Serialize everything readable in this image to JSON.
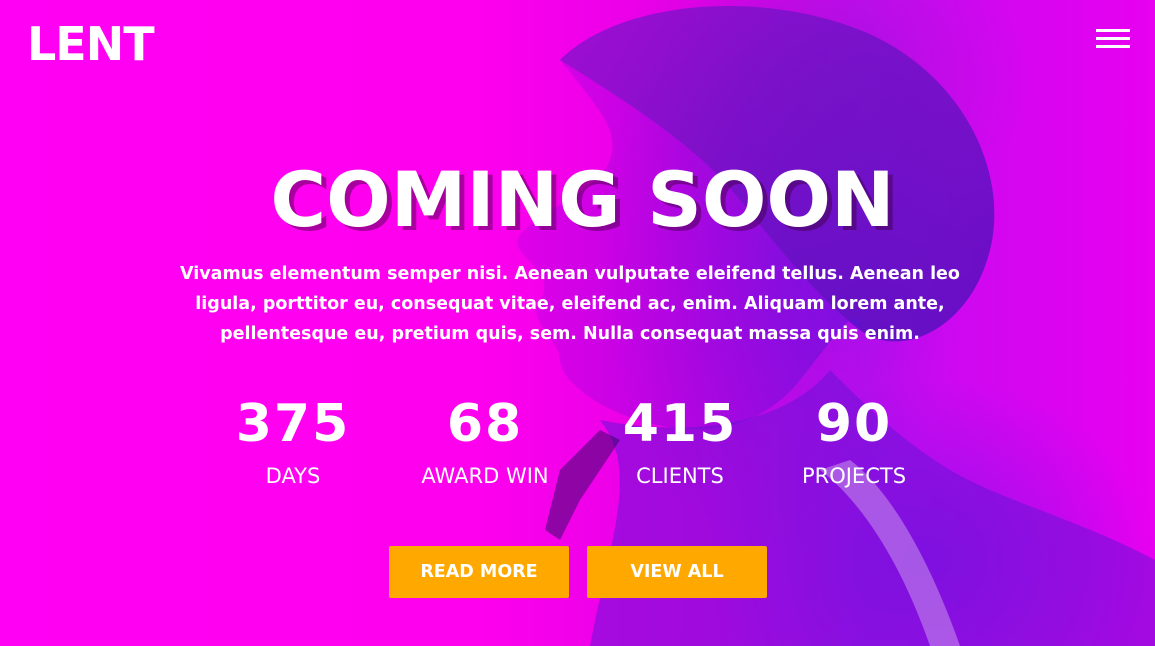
{
  "header": {
    "logo_text": "LENT",
    "menu_icon": "hamburger-menu-icon"
  },
  "hero": {
    "title": "COMING SOON",
    "description": "Vivamus elementum semper nisi. Aenean vulputate eleifend tellus. Aenean leo ligula, porttitor eu, consequat vitae, eleifend ac, enim. Aliquam lorem ante, pellentesque eu, pretium quis, sem. Nulla consequat massa quis enim."
  },
  "stats": [
    {
      "number": "375",
      "label": "DAYS"
    },
    {
      "number": "68",
      "label": "AWARD WIN"
    },
    {
      "number": "415",
      "label": "CLIENTS"
    },
    {
      "number": "90",
      "label": "PROJECTS"
    }
  ],
  "buttons": {
    "read_more": "READ MORE",
    "view_all": "VIEW ALL"
  },
  "colors": {
    "background": "#ff00ee",
    "accent": "#ffa800",
    "text": "#ffffff"
  }
}
